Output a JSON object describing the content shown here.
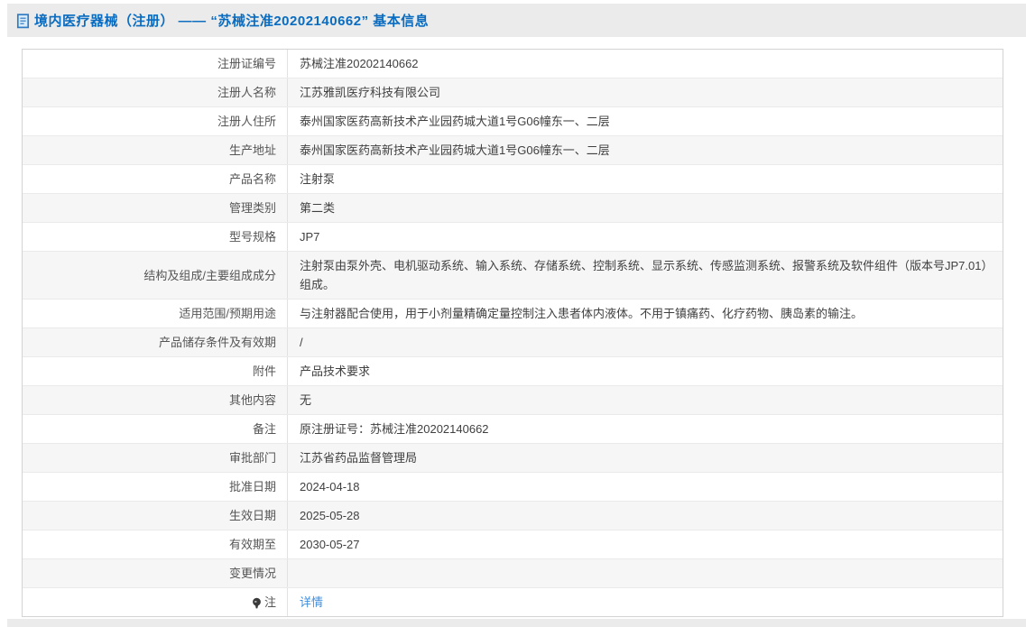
{
  "header": {
    "icon": "document-icon",
    "title": "境内医疗器械（注册） —— “苏械注准20202140662” 基本信息"
  },
  "table": {
    "rows": [
      {
        "label": "注册证编号",
        "value": "苏械注准20202140662"
      },
      {
        "label": "注册人名称",
        "value": "江苏雅凯医疗科技有限公司"
      },
      {
        "label": "注册人住所",
        "value": "泰州国家医药高新技术产业园药城大道1号G06幢东一、二层"
      },
      {
        "label": "生产地址",
        "value": "泰州国家医药高新技术产业园药城大道1号G06幢东一、二层"
      },
      {
        "label": "产品名称",
        "value": "注射泵"
      },
      {
        "label": "管理类别",
        "value": "第二类"
      },
      {
        "label": "型号规格",
        "value": "JP7"
      },
      {
        "label": "结构及组成/主要组成成分",
        "value": "注射泵由泵外壳、电机驱动系统、输入系统、存储系统、控制系统、显示系统、传感监测系统、报警系统及软件组件（版本号JP7.01）组成。"
      },
      {
        "label": "适用范围/预期用途",
        "value": "与注射器配合使用，用于小剂量精确定量控制注入患者体内液体。不用于镇痛药、化疗药物、胰岛素的输注。"
      },
      {
        "label": "产品储存条件及有效期",
        "value": "/"
      },
      {
        "label": "附件",
        "value": "产品技术要求"
      },
      {
        "label": "其他内容",
        "value": "无"
      },
      {
        "label": "备注",
        "value": "原注册证号：苏械注准20202140662"
      },
      {
        "label": "审批部门",
        "value": "江苏省药品监督管理局"
      },
      {
        "label": "批准日期",
        "value": "2024-04-18"
      },
      {
        "label": "生效日期",
        "value": "2025-05-28"
      },
      {
        "label": "有效期至",
        "value": "2030-05-27"
      },
      {
        "label": "变更情况",
        "value": ""
      },
      {
        "label": "注",
        "label_icon": "bulb-icon",
        "value": "详情",
        "value_type": "link"
      }
    ]
  },
  "colors": {
    "title_blue": "#0a6cc0",
    "link_blue": "#3e8ede",
    "band_gray": "#ebebeb",
    "alt_row_gray": "#f6f6f6"
  }
}
